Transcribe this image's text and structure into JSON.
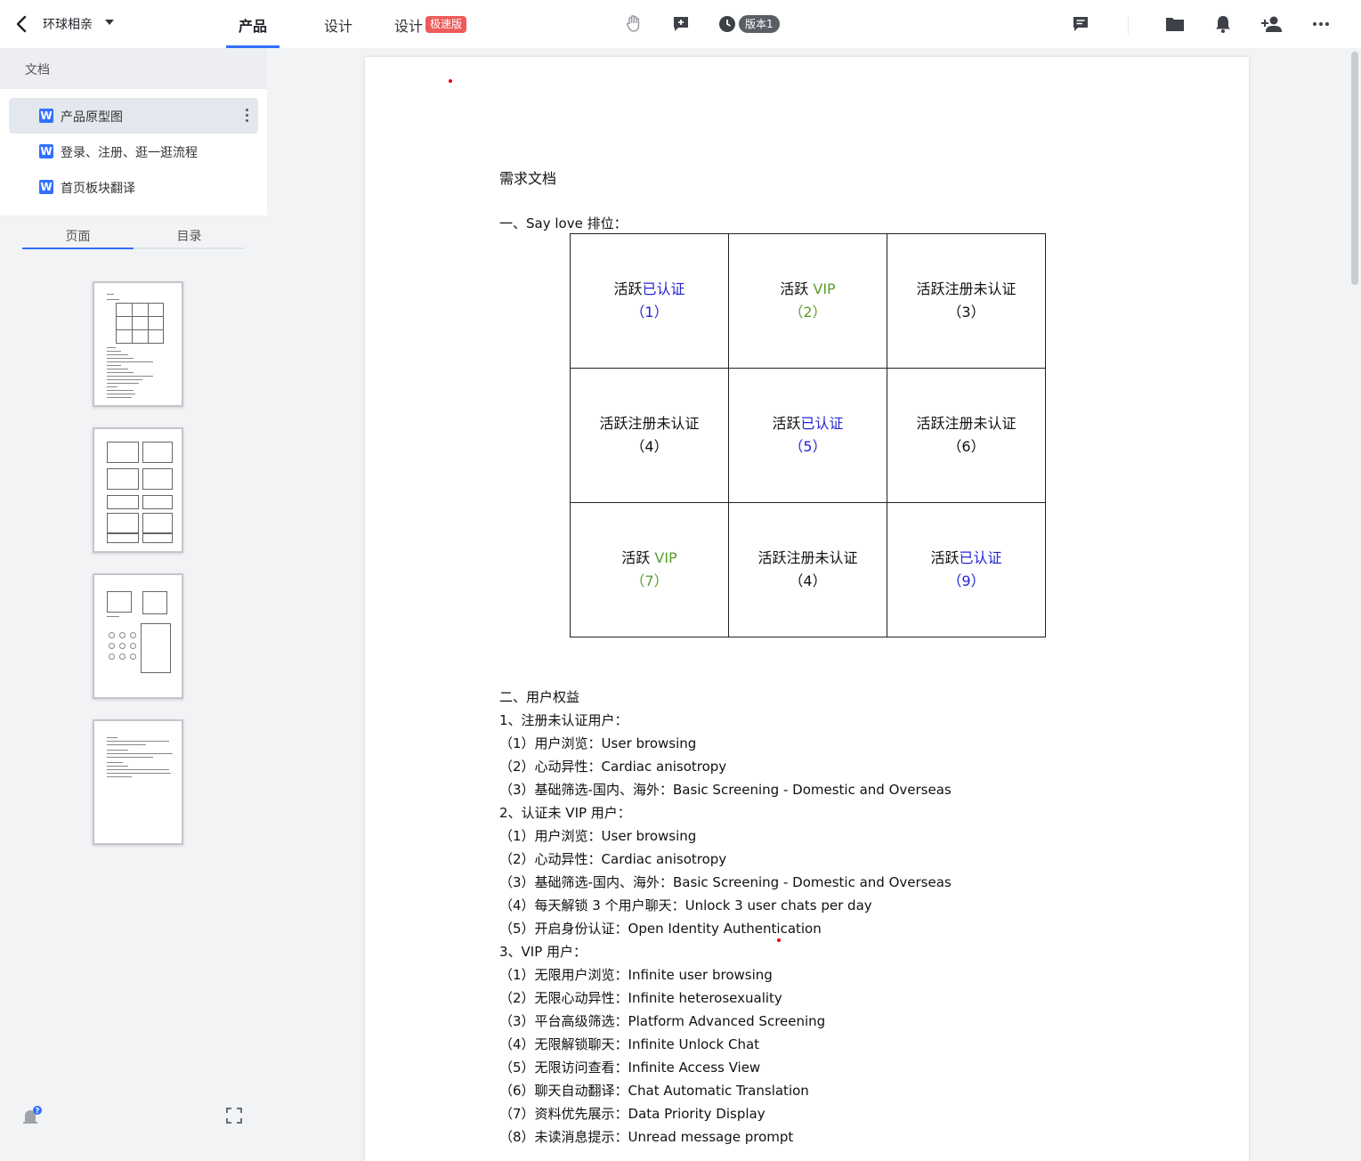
{
  "header": {
    "project_name": "环球相亲",
    "tabs": [
      {
        "label": "产品"
      },
      {
        "label": "设计"
      },
      {
        "label": "设计"
      }
    ],
    "speed_badge": "极速版",
    "version_label": "版本1"
  },
  "sidebar": {
    "section_title": "文档",
    "docs": [
      {
        "label": "产品原型图"
      },
      {
        "label": "登录、注册、逛一逛流程"
      },
      {
        "label": "首页板块翻译"
      }
    ],
    "doc_icon_letter": "W",
    "tabs": [
      {
        "label": "页面"
      },
      {
        "label": "目录"
      }
    ]
  },
  "document": {
    "title": "需求文档",
    "section1": "一、Say love  排位：",
    "grid": [
      [
        {
          "prefix": "活跃",
          "suffix": "已认证",
          "num": "（1）",
          "color": "blue"
        },
        {
          "prefix": "活跃 ",
          "suffix": "VIP",
          "num": "（2）",
          "color": "green"
        },
        {
          "prefix": "活跃注册未认证",
          "suffix": "",
          "num": "（3）",
          "color": "black"
        }
      ],
      [
        {
          "prefix": "活跃注册未认证",
          "suffix": "",
          "num": "（4）",
          "color": "black"
        },
        {
          "prefix": "活跃",
          "suffix": "已认证",
          "num": "（5）",
          "color": "blue"
        },
        {
          "prefix": "活跃注册未认证",
          "suffix": "",
          "num": "（6）",
          "color": "black"
        }
      ],
      [
        {
          "prefix": "活跃 ",
          "suffix": "VIP",
          "num": "（7）",
          "color": "green"
        },
        {
          "prefix": "活跃注册未认证",
          "suffix": "",
          "num": "（4）",
          "color": "black"
        },
        {
          "prefix": "活跃",
          "suffix": "已认证",
          "num": "（9）",
          "color": "blue"
        }
      ]
    ],
    "lines": [
      "二、用户权益",
      "1、注册未认证用户：",
      "（1）用户浏览：User browsing",
      "（2）心动异性：Cardiac anisotropy",
      "（3）基础筛选-国内、海外：Basic Screening - Domestic and Overseas",
      "2、认证未 VIP 用户：",
      "（1）用户浏览：User browsing",
      "（2）心动异性：Cardiac anisotropy",
      "（3）基础筛选-国内、海外：Basic Screening - Domestic and Overseas",
      "（4）每天解锁 3 个用户聊天：Unlock 3 user chats per day",
      "（5）开启身份认证：Open Identity Authentication",
      "3、VIP 用户：",
      "（1）无限用户浏览：Infinite user browsing",
      "（2）无限心动异性：Infinite heterosexuality",
      "（3）平台高级筛选：Platform Advanced Screening",
      "（4）无限解锁聊天：Infinite Unlock Chat",
      "（5）无限访问查看：Infinite Access View",
      "（6）聊天自动翻译：Chat Automatic Translation",
      "（7）资料优先展示：Data Priority Display",
      "（8）未读消息提示：Unread message prompt"
    ]
  },
  "colors": {
    "accent": "#3370ff",
    "badge_red": "#f05a5a",
    "cell_blue": "#2424d6",
    "cell_green": "#5a9e2c"
  },
  "icons": [
    "back-arrow-icon",
    "hand-icon",
    "add-comment-icon",
    "history-clock-icon",
    "comment-icon",
    "folder-icon",
    "bell-icon",
    "add-person-icon",
    "more-horizontal-icon",
    "help-icon",
    "fullscreen-icon",
    "word-doc-icon",
    "more-vertical-icon"
  ]
}
